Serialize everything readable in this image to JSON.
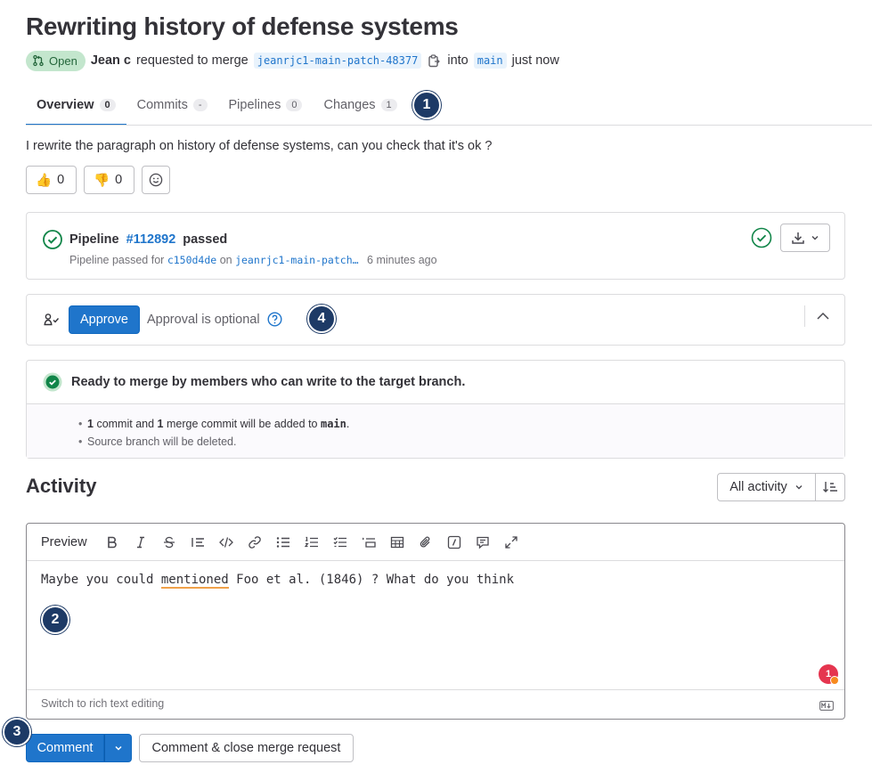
{
  "title": "Rewriting history of defense systems",
  "meta": {
    "status": "Open",
    "author": "Jean c",
    "requested_text": "requested to merge",
    "source_branch": "jeanrjc1-main-patch-48377",
    "into_text": "into",
    "target_branch": "main",
    "time": "just now"
  },
  "tabs": [
    {
      "label": "Overview",
      "count": "0"
    },
    {
      "label": "Commits",
      "count": "-"
    },
    {
      "label": "Pipelines",
      "count": "0"
    },
    {
      "label": "Changes",
      "count": "1"
    }
  ],
  "markers": [
    "1",
    "2",
    "3",
    "4"
  ],
  "description": "I rewrite the paragraph on history of defense systems, can you check that it's ok ?",
  "reactions": {
    "thumbs_up": "👍",
    "thumbs_up_count": "0",
    "thumbs_down": "👎",
    "thumbs_down_count": "0"
  },
  "pipeline": {
    "label": "Pipeline",
    "id": "#112892",
    "status": "passed",
    "sub_prefix": "Pipeline passed for",
    "commit": "c150d4de",
    "on_text": "on",
    "branch": "jeanrjc1-main-patch…",
    "time": "6 minutes ago"
  },
  "approval": {
    "button": "Approve",
    "text": "Approval is optional"
  },
  "merge": {
    "title": "Ready to merge by members who can write to the target branch.",
    "line1_a": "1",
    "line1_b": "commit and",
    "line1_c": "1",
    "line1_d": "merge commit will be added to",
    "line1_branch": "main",
    "line1_end": ".",
    "line2": "Source branch will be deleted."
  },
  "activity": {
    "title": "Activity",
    "filter": "All activity"
  },
  "editor": {
    "preview": "Preview",
    "text_before": "Maybe you could ",
    "text_misspelled": "mentioned",
    "text_after": " Foo et al. (1846) ? What do you think",
    "footer": "Switch to rich text editing",
    "notification_count": "1"
  },
  "actions": {
    "comment": "Comment",
    "close": "Comment & close merge request"
  },
  "colors": {
    "primary": "#1f75cb",
    "success": "#108548",
    "marker": "#1d3a66"
  }
}
